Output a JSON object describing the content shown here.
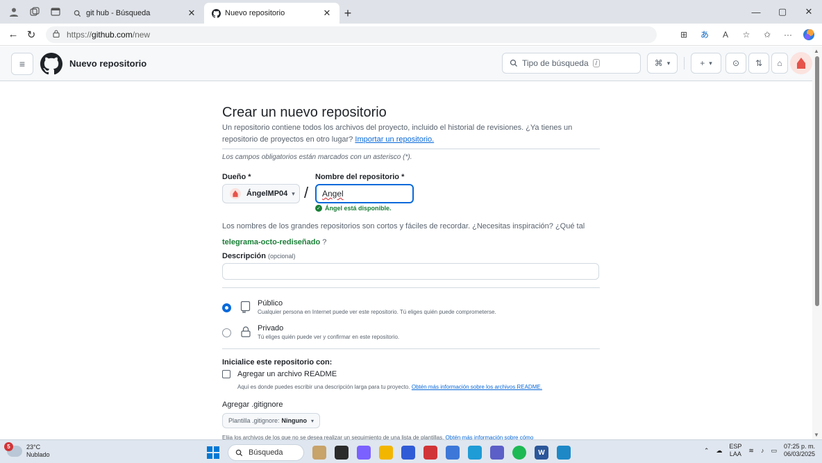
{
  "browser": {
    "tabs": [
      {
        "title": "git hub - Búsqueda",
        "active": false
      },
      {
        "title": "Nuevo repositorio",
        "active": true
      }
    ],
    "url_prefix": "https://",
    "url_host": "github.com",
    "url_path": "/new"
  },
  "header": {
    "title": "Nuevo repositorio",
    "search_placeholder": "Tipo de búsqueda",
    "search_kbd": "/"
  },
  "form": {
    "heading": "Crear un nuevo repositorio",
    "intro": "Un repositorio contiene todos los archivos del proyecto, incluido el historial de revisiones. ¿Ya tienes un repositorio de proyectos en otro lugar?",
    "import_link": "Importar un repositorio.",
    "required_note": "Los campos obligatorios están marcados con un asterisco (*).",
    "owner_label": "Dueño *",
    "owner_value": "ÁngelMP04",
    "repo_label": "Nombre del repositorio *",
    "repo_value": "Angel",
    "availability": "Ángel está disponible.",
    "hint": "Los nombres de los grandes repositorios son cortos y fáciles de recordar. ¿Necesitas inspiración? ¿Qué tal",
    "suggestion": "telegrama-octo-rediseñado",
    "hint_end": "?",
    "description_label": "Descripción",
    "description_optional": "(opcional)",
    "description_value": "",
    "visibility": [
      {
        "label": "Público",
        "desc": "Cualquier persona en Internet puede ver este repositorio. Tú eliges quién puede comprometerse.",
        "selected": true
      },
      {
        "label": "Privado",
        "desc": "Tú eliges quién puede ver y confirmar en este repositorio.",
        "selected": false
      }
    ],
    "init_heading": "Inicialice este repositorio con:",
    "readme_label": "Agregar un archivo README",
    "readme_checked": false,
    "readme_desc": "Aquí es donde puedes escribir una descripción larga para tu proyecto.",
    "readme_link": "Obtén más información sobre los archivos README.",
    "gitignore_heading": "Agregar .gitignore",
    "gitignore_prefix": "Plantilla .gitignore:",
    "gitignore_value": "Ninguno",
    "gitignore_desc": "Elija los archivos de los que no se desea realizar un seguimiento de una lista de plantillas.",
    "gitignore_link": "Obtén más información sobre cómo"
  },
  "taskbar": {
    "temp": "23°C",
    "weather": "Nublado",
    "notifications": "5",
    "search": "Búsqueda",
    "lang": "ESP",
    "region": "LAA",
    "time": "07:25 p. m.",
    "date": "06/03/2025"
  }
}
